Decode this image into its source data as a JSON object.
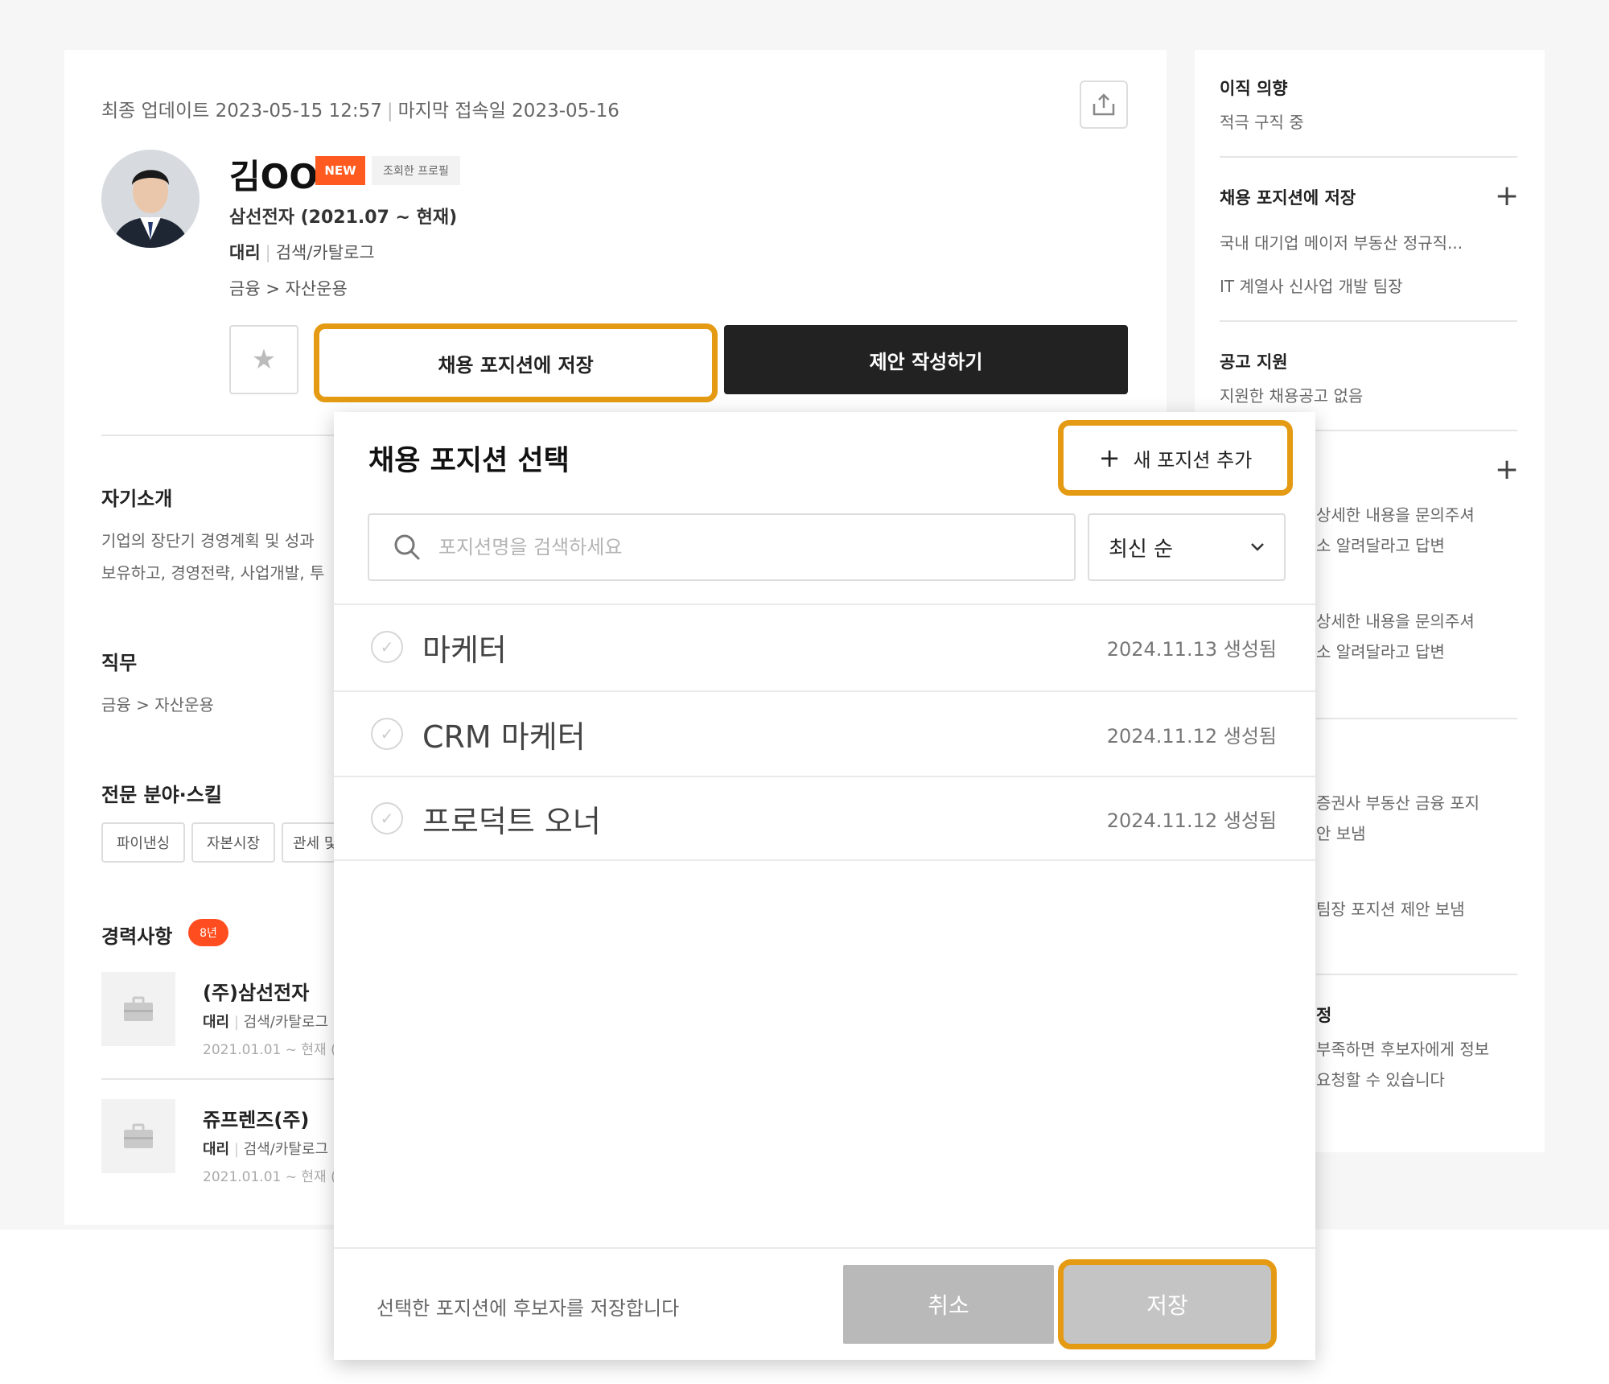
{
  "profile": {
    "last_update": "최종 업데이트 2023-05-15 12:57",
    "last_login": "마지막 접속일 2023-05-16",
    "name": "김OO",
    "badge_new": "NEW",
    "badge_viewed": "조회한 프로필",
    "company": "삼선전자 (2021.07 ~ 현재)",
    "position": "대리",
    "department": "검색/카탈로그",
    "field": "금융 > 자산운용",
    "save_position_label": "채용 포지션에 저장",
    "propose_label": "제안 작성하기"
  },
  "sections": {
    "intro_title": "자기소개",
    "intro_line1": "기업의 장단기 경영계획 및 성과",
    "intro_line2": "보유하고, 경영전략, 사업개발, 투",
    "job_title": "직무",
    "job_value": "금융 > 자산운용",
    "skills_title": "전문 분야·스킬",
    "skills": [
      "파이낸싱",
      "자본시장",
      "관세 및"
    ],
    "career_title": "경력사항",
    "career_years": "8년",
    "experiences": [
      {
        "name": "(주)삼선전자",
        "position": "대리",
        "department": "검색/카탈로그",
        "date": "2021.01.01 ~ 현재 ("
      },
      {
        "name": "쥬프렌즈(주)",
        "position": "대리",
        "department": "검색/카탈로그",
        "date": "2021.01.01 ~ 현재 ("
      }
    ]
  },
  "side": {
    "intent_title": "이직 의향",
    "intent_value": "적극 구직 중",
    "saved_title": "채용 포지션에 저장",
    "saved_items": [
      "국내 대기업 메이저 부동산 정규직...",
      "IT 계열사 신사업 개발 팀장"
    ],
    "apply_title": "공고 지원",
    "apply_value": "지원한 채용공고 없음",
    "q1_line1": "상세한 내용을 문의주셔",
    "q1_line2": "소 알려달라고 답변",
    "q2_line1": "상세한 내용을 문의주셔",
    "q2_line2": "소 알려달라고 답변",
    "p1_line1": "증권사 부동산 금융 포지",
    "p1_line2": "안 보냄",
    "p2_line1": "팀장 포지션 제안 보냄",
    "r_title": "정",
    "r_line1": "부족하면 후보자에게 정보",
    "r_line2": "요청할 수 있습니다"
  },
  "modal": {
    "title": "채용 포지션 선택",
    "add_label": "새 포지션 추가",
    "search_placeholder": "포지션명을 검색하세요",
    "sort_value": "최신 순",
    "positions": [
      {
        "name": "마케터",
        "created": "2024.11.13 생성됨"
      },
      {
        "name": "CRM 마케터",
        "created": "2024.11.12 생성됨"
      },
      {
        "name": "프로덕트 오너",
        "created": "2024.11.12 생성됨"
      }
    ],
    "footer_text": "선택한 포지션에 후보자를 저장합니다",
    "cancel_label": "취소",
    "save_label": "저장"
  },
  "colors": {
    "highlight": "#e49a12",
    "new_badge": "#ff5a1f",
    "dark_button": "#222222"
  }
}
